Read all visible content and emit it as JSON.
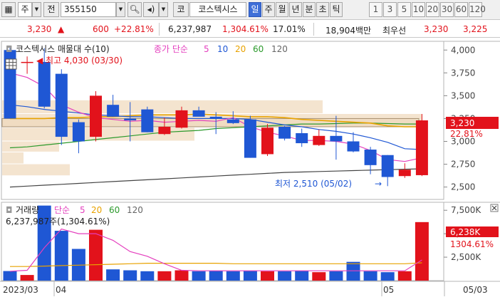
{
  "toolbar": {
    "market": "주",
    "code_label": "전",
    "code_value": "355150",
    "kor_btn": "코",
    "stock_name": "코스텍시스",
    "periods": [
      "일",
      "주",
      "월",
      "년",
      "분",
      "초",
      "틱"
    ],
    "selected_period": "일",
    "intervals": [
      "1",
      "3",
      "5",
      "10",
      "20",
      "30",
      "60",
      "120"
    ]
  },
  "quote": {
    "price": "3,230",
    "arrow": "▲",
    "change": "600",
    "change_pct": "+22.81%",
    "volume": "6,237,987",
    "volume_pct": "1,304.61%",
    "turnover": "17.01%",
    "amount": "18,904백만",
    "best_ask_label": "최우선",
    "best_ask": "3,230",
    "best_bid": "3,225"
  },
  "price_chart": {
    "title": "코스텍시스 매물대 수(10)",
    "ma_label": "종가 단순",
    "ma_periods": [
      "5",
      "10",
      "20",
      "60",
      "120"
    ],
    "high_annotation": "최고 4,030 (03/30)",
    "low_annotation": "최저 2,510 (05/02)",
    "y_ticks": [
      "4,000",
      "3,750",
      "3,500",
      "3,250",
      "3,000",
      "2,750",
      "2,500"
    ],
    "current_price_tag": "3,230",
    "current_pct_tag": "22.81%"
  },
  "volume_chart": {
    "title": "거래량",
    "ma_label": "단순",
    "ma_periods": [
      "5",
      "20",
      "60",
      "120"
    ],
    "summary": "6,237,987주(1,304.61%)",
    "y_ticks": [
      "7,500K",
      "5,000K",
      "2,500K"
    ],
    "current_volume_tag": "6,238K",
    "current_pct_tag": "1304.61%"
  },
  "x_axis": {
    "labels": [
      "2023/03",
      "04",
      "05",
      "05/03"
    ]
  },
  "colors": {
    "up": "#e2121b",
    "down": "#1f57d4",
    "ma5": "#e43fbe",
    "ma10": "#1f57d4",
    "ma20": "#e8a200",
    "ma60": "#2c9a2c",
    "ma120": "#444444"
  },
  "chart_data": {
    "type": "candlestick",
    "candles": [
      {
        "o": 4000,
        "h": 4030,
        "l": 3250,
        "c": 3250
      },
      {
        "o": 3870,
        "h": 3930,
        "l": 3740,
        "c": 3870
      },
      {
        "o": 3870,
        "h": 4020,
        "l": 3360,
        "c": 3380
      },
      {
        "o": 3740,
        "h": 3790,
        "l": 2960,
        "c": 3050
      },
      {
        "o": 3210,
        "h": 3240,
        "l": 2870,
        "c": 3000
      },
      {
        "o": 3050,
        "h": 3550,
        "l": 3000,
        "c": 3500
      },
      {
        "o": 3400,
        "h": 3510,
        "l": 3270,
        "c": 3270
      },
      {
        "o": 3250,
        "h": 3430,
        "l": 3000,
        "c": 3230
      },
      {
        "o": 3350,
        "h": 3380,
        "l": 3100,
        "c": 3100
      },
      {
        "o": 3080,
        "h": 3260,
        "l": 3070,
        "c": 3160
      },
      {
        "o": 3150,
        "h": 3380,
        "l": 3140,
        "c": 3340
      },
      {
        "o": 3340,
        "h": 3380,
        "l": 3300,
        "c": 3270
      },
      {
        "o": 3270,
        "h": 3320,
        "l": 3080,
        "c": 3250
      },
      {
        "o": 3240,
        "h": 3330,
        "l": 3190,
        "c": 3200
      },
      {
        "o": 3240,
        "h": 3280,
        "l": 2820,
        "c": 2820
      },
      {
        "o": 2860,
        "h": 3190,
        "l": 2840,
        "c": 3150
      },
      {
        "o": 3160,
        "h": 3170,
        "l": 3010,
        "c": 3030
      },
      {
        "o": 3090,
        "h": 3140,
        "l": 2940,
        "c": 2980
      },
      {
        "o": 2960,
        "h": 3130,
        "l": 2950,
        "c": 3060
      },
      {
        "o": 3060,
        "h": 3280,
        "l": 2800,
        "c": 3000
      },
      {
        "o": 3000,
        "h": 3100,
        "l": 2880,
        "c": 2890
      },
      {
        "o": 2910,
        "h": 2940,
        "l": 2640,
        "c": 2740
      },
      {
        "o": 2850,
        "h": 2850,
        "l": 2510,
        "c": 2610
      },
      {
        "o": 2620,
        "h": 2760,
        "l": 2600,
        "c": 2690
      },
      {
        "o": 2630,
        "h": 3300,
        "l": 2620,
        "c": 3230
      }
    ],
    "volume_k": [
      1020,
      600,
      8000,
      5310,
      3380,
      5420,
      1200,
      1100,
      1000,
      1000,
      1100,
      1000,
      1050,
      1000,
      1050,
      1000,
      1000,
      1050,
      900,
      1000,
      2000,
      1000,
      900,
      1000,
      6238
    ],
    "ma5": [
      3750,
      3700,
      3600,
      3400,
      3320,
      3260,
      3240,
      3220,
      3230,
      3210,
      3220,
      3230,
      3220,
      3260,
      3160,
      3100,
      3060,
      3010,
      3010,
      3000,
      2970,
      2900,
      2800,
      2780,
      2820
    ],
    "ma10": [
      3400,
      3380,
      3350,
      3330,
      3310,
      3290,
      3280,
      3270,
      3270,
      3260,
      3250,
      3250,
      3250,
      3250,
      3240,
      3210,
      3180,
      3160,
      3130,
      3110,
      3080,
      3040,
      2990,
      2920,
      2910
    ],
    "ma20": [
      3250,
      3250,
      3250,
      3260,
      3260,
      3270,
      3270,
      3280,
      3290,
      3290,
      3290,
      3300,
      3290,
      3280,
      3270,
      3270,
      3260,
      3240,
      3230,
      3220,
      3210,
      3200,
      3170,
      3160,
      3160
    ],
    "ma60": [
      2930,
      2940,
      2960,
      2980,
      3000,
      3020,
      3040,
      3060,
      3080,
      3100,
      3110,
      3120,
      3140,
      3150,
      3160,
      3170,
      3180,
      3190,
      3190,
      3195,
      3200,
      3200,
      3195,
      3190,
      3190
    ],
    "ma120": [
      2500,
      2510,
      2520,
      2530,
      2540,
      2550,
      2560,
      2570,
      2580,
      2590,
      2600,
      2610,
      2620,
      2630,
      2640,
      2650,
      2660,
      2665,
      2670,
      2675,
      2680,
      2685,
      2690,
      2695,
      2700
    ],
    "volume_ma5": [
      1000,
      1100,
      3500,
      5500,
      5000,
      5000,
      4300,
      3100,
      2600,
      1800,
      1100,
      1050,
      1050,
      1050,
      1050,
      1050,
      1050,
      1050,
      1050,
      1050,
      1050,
      1050,
      1050,
      1050,
      2200
    ],
    "volume_ma20": [
      1500,
      1500,
      1550,
      1600,
      1650,
      1700,
      1750,
      1800,
      1850,
      1850,
      1850,
      1850,
      1850,
      1800,
      1800,
      1800,
      1800,
      1800,
      1800,
      1800,
      1800,
      1800,
      1800,
      1800,
      1900
    ],
    "y_range": [
      2380,
      4080
    ],
    "volume_range_k": [
      0,
      8200
    ]
  }
}
